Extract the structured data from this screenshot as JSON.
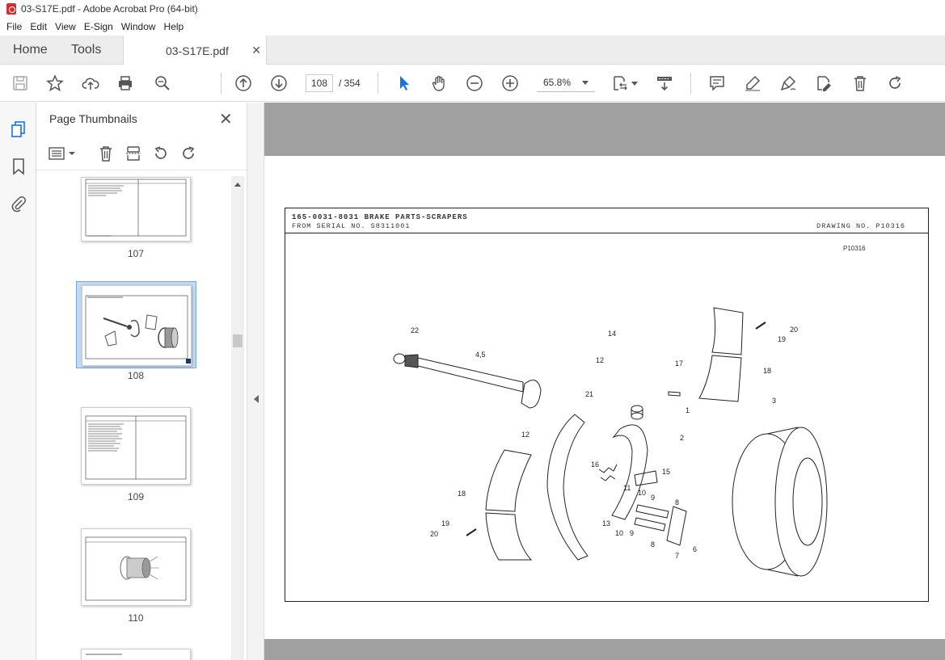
{
  "window": {
    "title": "03-S17E.pdf - Adobe Acrobat Pro (64-bit)"
  },
  "menu": [
    "File",
    "Edit",
    "View",
    "E-Sign",
    "Window",
    "Help"
  ],
  "tabs": {
    "home": "Home",
    "tools": "Tools",
    "doc": "03-S17E.pdf"
  },
  "toolbar": {
    "page_current": "108",
    "page_total": "/ 354",
    "zoom": "65.8%"
  },
  "panel": {
    "title": "Page Thumbnails",
    "thumbs": [
      "107",
      "108",
      "109",
      "110"
    ]
  },
  "document": {
    "part_title": "165-0031-8031 BRAKE PARTS-SCRAPERS",
    "serial": "FROM SERIAL NO. S8311001",
    "drawing_no": "DRAWING NO. P10316",
    "figure_id": "P10316",
    "callouts": [
      "22",
      "4,5",
      "14",
      "12",
      "17",
      "20",
      "19",
      "18",
      "21",
      "1",
      "12",
      "2",
      "3",
      "16",
      "15",
      "11",
      "10",
      "9",
      "18",
      "8",
      "19",
      "13",
      "10",
      "9",
      "20",
      "8",
      "7",
      "6"
    ]
  },
  "colors": {
    "accent": "#1473e6",
    "canvas": "#a0a0a0",
    "pdf_red": "#d32f2f"
  }
}
